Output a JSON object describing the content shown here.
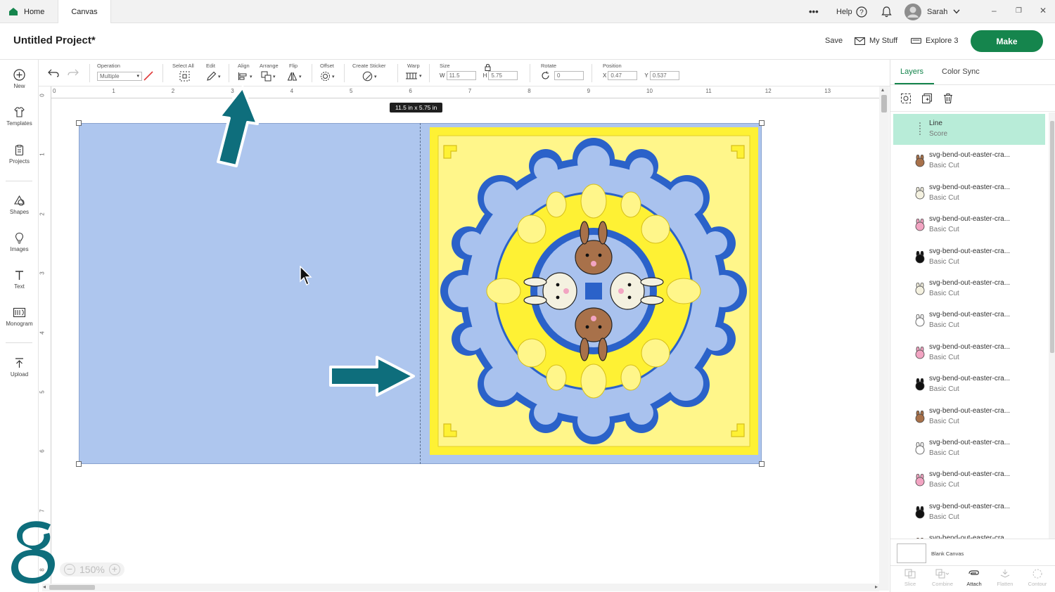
{
  "tabs": {
    "home": "Home",
    "canvas": "Canvas"
  },
  "topbar": {
    "more": "•••",
    "help": "Help",
    "user": "Sarah"
  },
  "header": {
    "title": "Untitled Project*",
    "save": "Save",
    "my_stuff": "My Stuff",
    "explore": "Explore 3",
    "make": "Make"
  },
  "sidebar": {
    "items": [
      "New",
      "Templates",
      "Projects",
      "Shapes",
      "Images",
      "Text",
      "Monogram",
      "Upload"
    ]
  },
  "toolbar": {
    "operation_label": "Operation",
    "operation_value": "Multiple",
    "select_all": "Select All",
    "edit": "Edit",
    "align": "Align",
    "arrange": "Arrange",
    "flip": "Flip",
    "offset": "Offset",
    "create_sticker": "Create Sticker",
    "warp": "Warp",
    "size_label": "Size",
    "w_label": "W",
    "w_value": "11.5",
    "h_label": "H",
    "h_value": "5.75",
    "rotate_label": "Rotate",
    "rotate_value": "0",
    "position_label": "Position",
    "x_label": "X",
    "x_value": "0.47",
    "y_label": "Y",
    "y_value": "0.537"
  },
  "ruler": {
    "top": [
      "0",
      "1",
      "2",
      "3",
      "4",
      "5",
      "6",
      "7",
      "8",
      "9",
      "10",
      "11",
      "12",
      "13"
    ],
    "left": [
      "0",
      "1",
      "2",
      "3",
      "4",
      "5",
      "6",
      "7",
      "8"
    ]
  },
  "canvas": {
    "dimension_badge": "11.5  in x 5.75  in",
    "zoom": "150%"
  },
  "colors": {
    "card_blue": "#aec6ee",
    "pattern_yellow": "#fef58a",
    "pattern_blue": "#2b62c9",
    "brand_green": "#15854d",
    "arrow_teal": "#0e6e7c"
  },
  "panel": {
    "tabs": [
      "Layers",
      "Color Sync"
    ],
    "layers": [
      {
        "name": "Line",
        "op": "Score",
        "icon": "score-line-icon"
      },
      {
        "name": "svg-bend-out-easter-cra...",
        "op": "Basic Cut",
        "icon": "brown-bunny-icon"
      },
      {
        "name": "svg-bend-out-easter-cra...",
        "op": "Basic Cut",
        "icon": "white-bunny-icon"
      },
      {
        "name": "svg-bend-out-easter-cra...",
        "op": "Basic Cut",
        "icon": "pink-bunny-icon"
      },
      {
        "name": "svg-bend-out-easter-cra...",
        "op": "Basic Cut",
        "icon": "black-bunny-icon"
      },
      {
        "name": "svg-bend-out-easter-cra...",
        "op": "Basic Cut",
        "icon": "white-bunny-side-icon"
      },
      {
        "name": "svg-bend-out-easter-cra...",
        "op": "Basic Cut",
        "icon": "outline-bunny-icon"
      },
      {
        "name": "svg-bend-out-easter-cra...",
        "op": "Basic Cut",
        "icon": "pink-bunny-side-icon"
      },
      {
        "name": "svg-bend-out-easter-cra...",
        "op": "Basic Cut",
        "icon": "black-bunny-side-icon"
      },
      {
        "name": "svg-bend-out-easter-cra...",
        "op": "Basic Cut",
        "icon": "brown-bunny-down-icon"
      },
      {
        "name": "svg-bend-out-easter-cra...",
        "op": "Basic Cut",
        "icon": "outline-bunny-down-icon"
      },
      {
        "name": "svg-bend-out-easter-cra...",
        "op": "Basic Cut",
        "icon": "pink-bunny-down-icon"
      },
      {
        "name": "svg-bend-out-easter-cra...",
        "op": "Basic Cut",
        "icon": "black-bunny-down-icon"
      },
      {
        "name": "svg-bend-out-easter-cra",
        "op": "",
        "icon": "bunny-icon"
      }
    ],
    "blank_canvas": "Blank Canvas",
    "bottom": [
      "Slice",
      "Combine",
      "Attach",
      "Flatten",
      "Contour"
    ]
  }
}
